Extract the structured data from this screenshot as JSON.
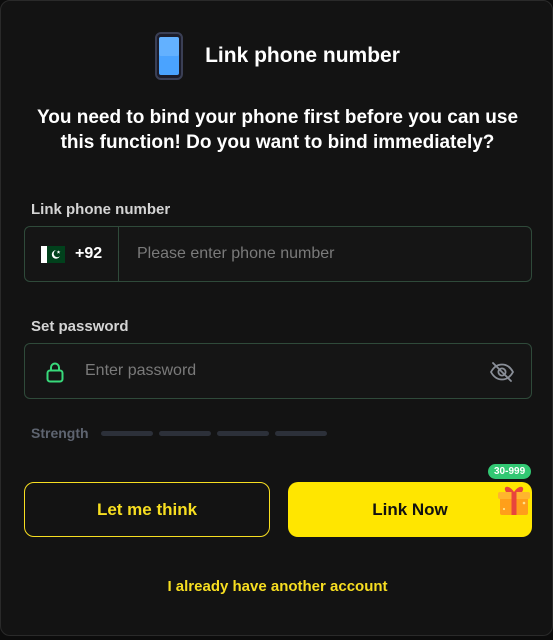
{
  "dialog": {
    "title": "Link phone number",
    "notice": "You need to bind your phone first before you can use this function! Do you want to bind immediately?"
  },
  "phone": {
    "label": "Link phone number",
    "country_code": "+92",
    "flag_icon": "pakistan-flag-icon",
    "placeholder": "Please enter phone number",
    "value": ""
  },
  "password": {
    "label": "Set password",
    "placeholder": "Enter password",
    "value": "",
    "lock_icon": "lock-icon",
    "visibility_icon": "eye-off-icon"
  },
  "strength": {
    "label": "Strength",
    "level": 0,
    "segments": 4
  },
  "buttons": {
    "think_label": "Let me think",
    "link_label": "Link Now"
  },
  "reward": {
    "badge": "30-999",
    "icon": "gift-box-icon"
  },
  "footer": {
    "another_account": "I already have another account"
  },
  "colors": {
    "accent_yellow": "#ffe600",
    "badge_green": "#32c873",
    "field_border": "#2f4a3a",
    "lock_green": "#38d97a"
  }
}
